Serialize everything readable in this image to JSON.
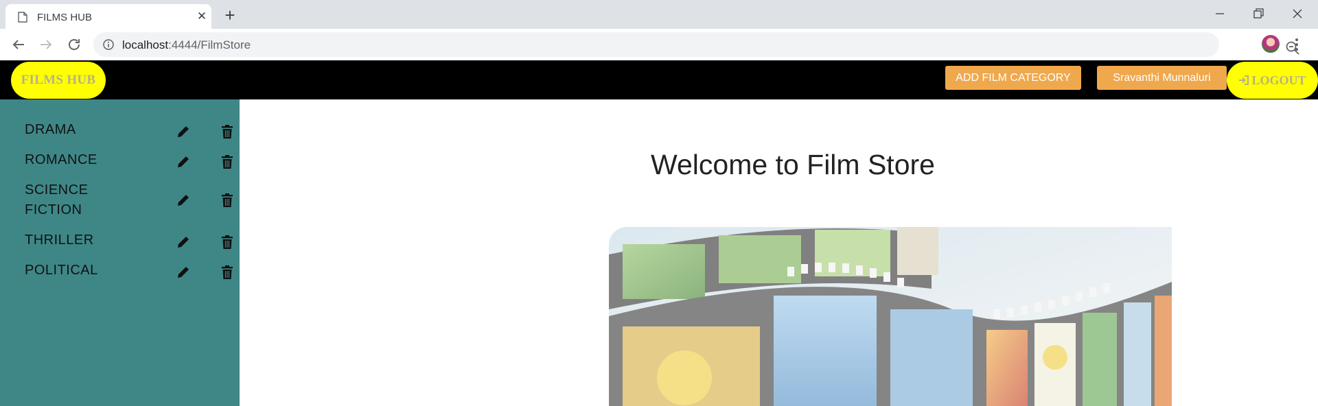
{
  "browser": {
    "tab_title": "FILMS HUB",
    "tab_close": "✕",
    "new_tab": "+",
    "url_host": "localhost",
    "url_rest": ":4444/FilmStore"
  },
  "header": {
    "brand": "FILMS HUB",
    "add_category_label": "ADD FILM CATEGORY",
    "user_label": "Sravanthi Munnaluri",
    "logout_label": "LOGOUT"
  },
  "sidebar": {
    "categories": [
      {
        "label": "DRAMA"
      },
      {
        "label": "ROMANCE"
      },
      {
        "label": "SCIENCE FICTION"
      },
      {
        "label": "THRILLER"
      },
      {
        "label": "POLITICAL"
      }
    ],
    "item_icons": [
      "pencil-icon",
      "trash-icon"
    ]
  },
  "main": {
    "welcome_title": "Welcome to Film Store"
  },
  "colors": {
    "header_bg": "#000000",
    "brand_bg": "#ffff00",
    "button_orange": "#f0a84d",
    "sidebar_bg": "#3f8787"
  }
}
